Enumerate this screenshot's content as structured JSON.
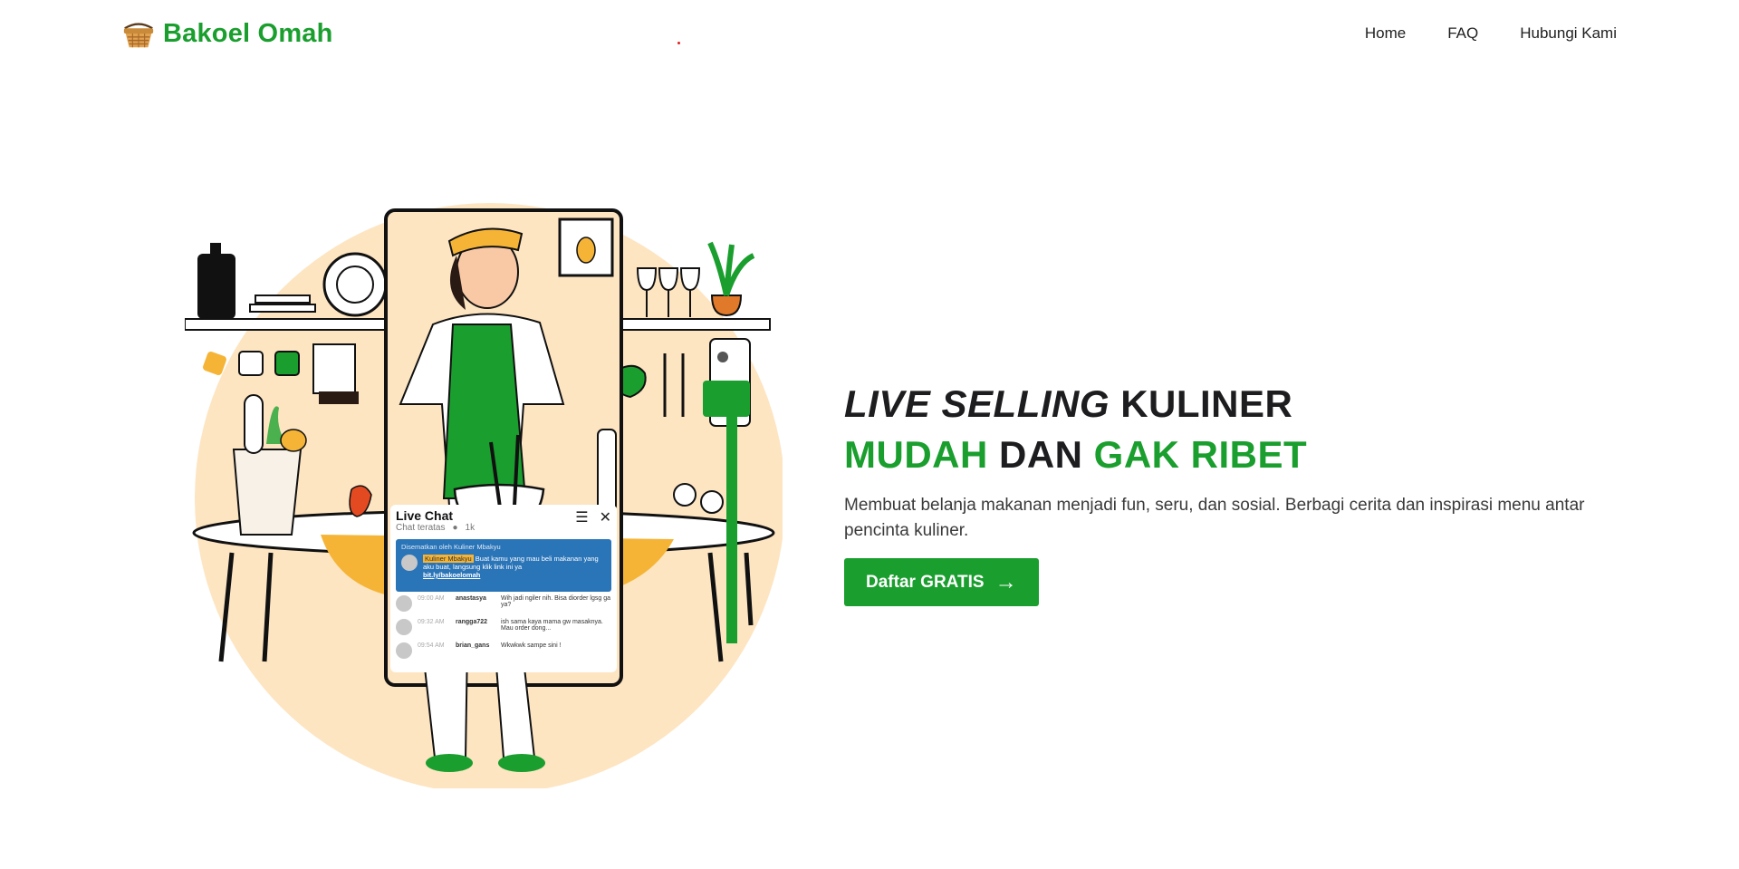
{
  "brand": {
    "name": "Bakoel Omah"
  },
  "nav": {
    "links": [
      "Home",
      "FAQ",
      "Hubungi Kami"
    ]
  },
  "hero": {
    "headline_part1_italic": "LIVE SELLING",
    "headline_part1_rest": " KULINER",
    "headline_green1": "MUDAH",
    "headline_mid": " DAN ",
    "headline_green2": "GAK RIBET",
    "subtext": "Membuat belanja makanan menjadi fun, seru, dan sosial. Berbagi cerita dan inspirasi menu antar pencinta kuliner.",
    "cta_label": "Daftar GRATIS"
  },
  "chat": {
    "title": "Live Chat",
    "subtitle": "Chat teratas",
    "viewers": "1k",
    "pinned_label": "Disematkan oleh Kuliner Mbakyu",
    "pinned_user": "Kuliner Mbakyu",
    "pinned_text": "Buat kamu yang mau beli makanan yang aku buat, langsung klik link ini ya",
    "pinned_link": "bit.ly/bakoelomah",
    "messages": [
      {
        "time": "09:00 AM",
        "user": "anastasya",
        "text": "Wih jadi ngiler nih. Bisa diorder lgsg ga ya?"
      },
      {
        "time": "09:32 AM",
        "user": "rangga722",
        "text": "ish sama kaya mama gw masaknya. Mau order dong..."
      },
      {
        "time": "09:54 AM",
        "user": "brian_gans",
        "text": "Wkwkwk sampe sini !"
      }
    ]
  },
  "colors": {
    "brand_green": "#1a9e2e",
    "peach": "#fde5c2",
    "accent_yellow": "#f5b436"
  }
}
